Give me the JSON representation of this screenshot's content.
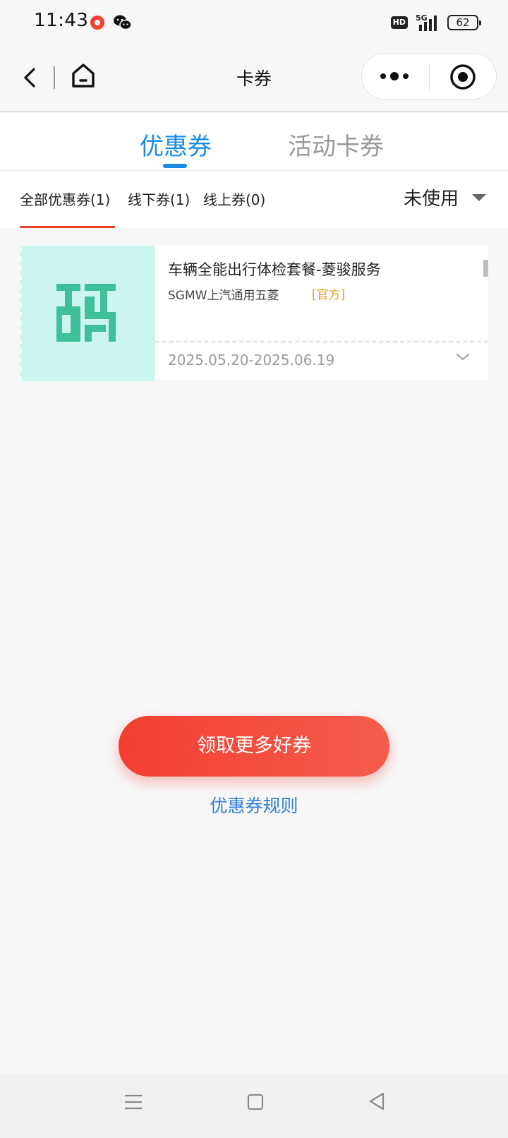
{
  "status_bar": {
    "time": "11:43",
    "network_badge": "HD",
    "network_type": "5G",
    "battery": "62"
  },
  "navbar": {
    "title": "卡券"
  },
  "main_tabs": [
    {
      "label": "优惠券",
      "active": true
    },
    {
      "label": "活动卡券",
      "active": false
    }
  ],
  "sub_tabs": [
    {
      "label": "全部优惠券(1)",
      "active": true
    },
    {
      "label": "线下券(1)",
      "active": false
    },
    {
      "label": "线上券(0)",
      "active": false
    }
  ],
  "status_filter": {
    "selected": "未使用"
  },
  "coupons": [
    {
      "title": "车辆全能出行体检套餐-菱骏服务",
      "merchant": "SGMW上汽通用五菱",
      "tag": "[官方]",
      "validity": "2025.05.20-2025.06.19",
      "icon": "code-icon"
    }
  ],
  "actions": {
    "get_more": "领取更多好券",
    "rules": "优惠券规则"
  },
  "colors": {
    "accent_blue": "#1a8ce6",
    "accent_red": "#f33f32",
    "tag_gold": "#e0a21e",
    "coupon_mint": "#cdf5ef",
    "icon_green": "#3fc09a"
  }
}
